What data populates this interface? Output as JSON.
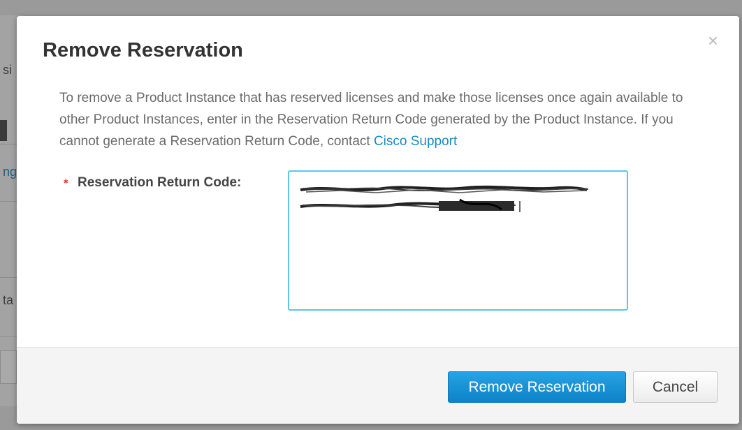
{
  "background": {
    "fragments": [
      "si",
      "ng",
      "ta"
    ]
  },
  "modal": {
    "title": "Remove Reservation",
    "close_glyph": "×",
    "description": "To remove a Product Instance that has reserved licenses and make those licenses once again available to other Product Instances, enter in the Reservation Return Code generated by the Product Instance. If you cannot generate a Reservation Return Code, contact",
    "support_link": "Cisco Support",
    "field": {
      "required_marker": "*",
      "label": "Reservation Return Code:",
      "value_redacted": true
    },
    "buttons": {
      "primary": "Remove Reservation",
      "cancel": "Cancel"
    }
  },
  "colors": {
    "primary_button": "#1a8fd6",
    "link": "#1a8ac4",
    "required": "#d63b3b",
    "focus_border": "#5ec6ea"
  },
  "icons": {
    "close": "close-icon"
  }
}
